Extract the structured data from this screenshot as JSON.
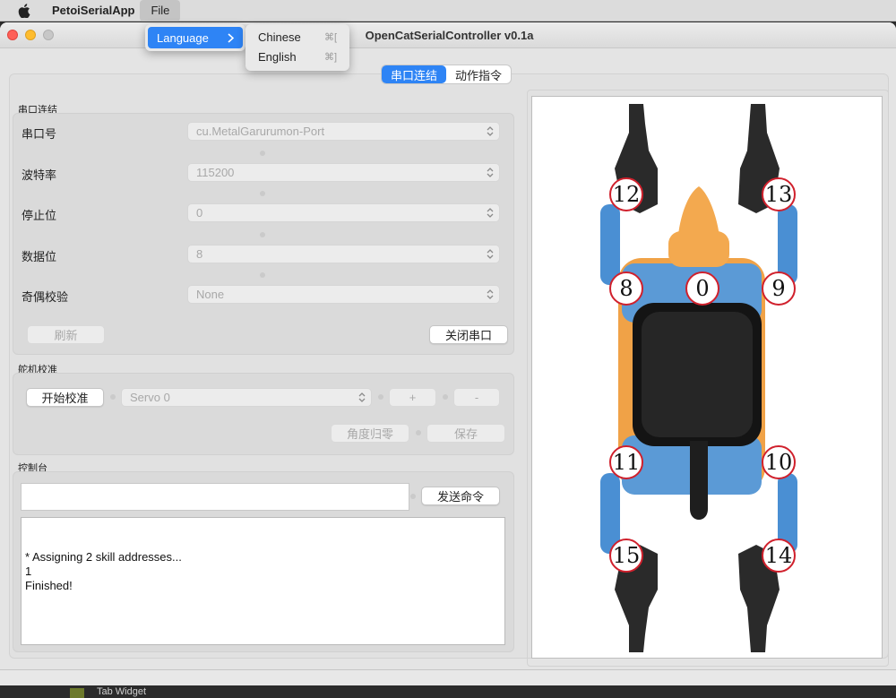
{
  "menubar": {
    "app_name": "PetoiSerialApp",
    "file_menu": "File"
  },
  "file_menu": {
    "items": [
      {
        "label": "Language"
      }
    ]
  },
  "language_submenu": {
    "items": [
      {
        "label": "Chinese",
        "shortcut": "⌘["
      },
      {
        "label": "English",
        "shortcut": "⌘]"
      }
    ]
  },
  "window": {
    "title": "OpenCatSerialController v0.1a"
  },
  "tabs": [
    {
      "label": "串口连结",
      "active": true
    },
    {
      "label": "动作指令",
      "active": false
    }
  ],
  "serial": {
    "group_title": "串口连结",
    "fields": [
      {
        "label": "串口号",
        "value": "cu.MetalGarurumon-Port"
      },
      {
        "label": "波特率",
        "value": "115200"
      },
      {
        "label": "停止位",
        "value": "0"
      },
      {
        "label": "数据位",
        "value": "8"
      },
      {
        "label": "奇偶校验",
        "value": "None"
      }
    ],
    "refresh_label": "刷新",
    "close_port_label": "关闭串口"
  },
  "servo": {
    "group_title": "舵机校准",
    "start_label": "开始校准",
    "servo_value": "Servo 0",
    "plus_label": "+",
    "minus_label": "-",
    "zero_label": "角度归零",
    "save_label": "保存"
  },
  "console": {
    "group_title": "控制台",
    "send_label": "发送命令",
    "input_value": "",
    "output_lines": "\n* Assigning 2 skill addresses...\n1\nFinished!"
  },
  "robot": {
    "joints": [
      "12",
      "13",
      "8",
      "0",
      "9",
      "11",
      "10",
      "15",
      "14"
    ],
    "joint_ring_color": "#d0202c"
  },
  "background": {
    "tab_widget_label": "Tab Widget"
  }
}
